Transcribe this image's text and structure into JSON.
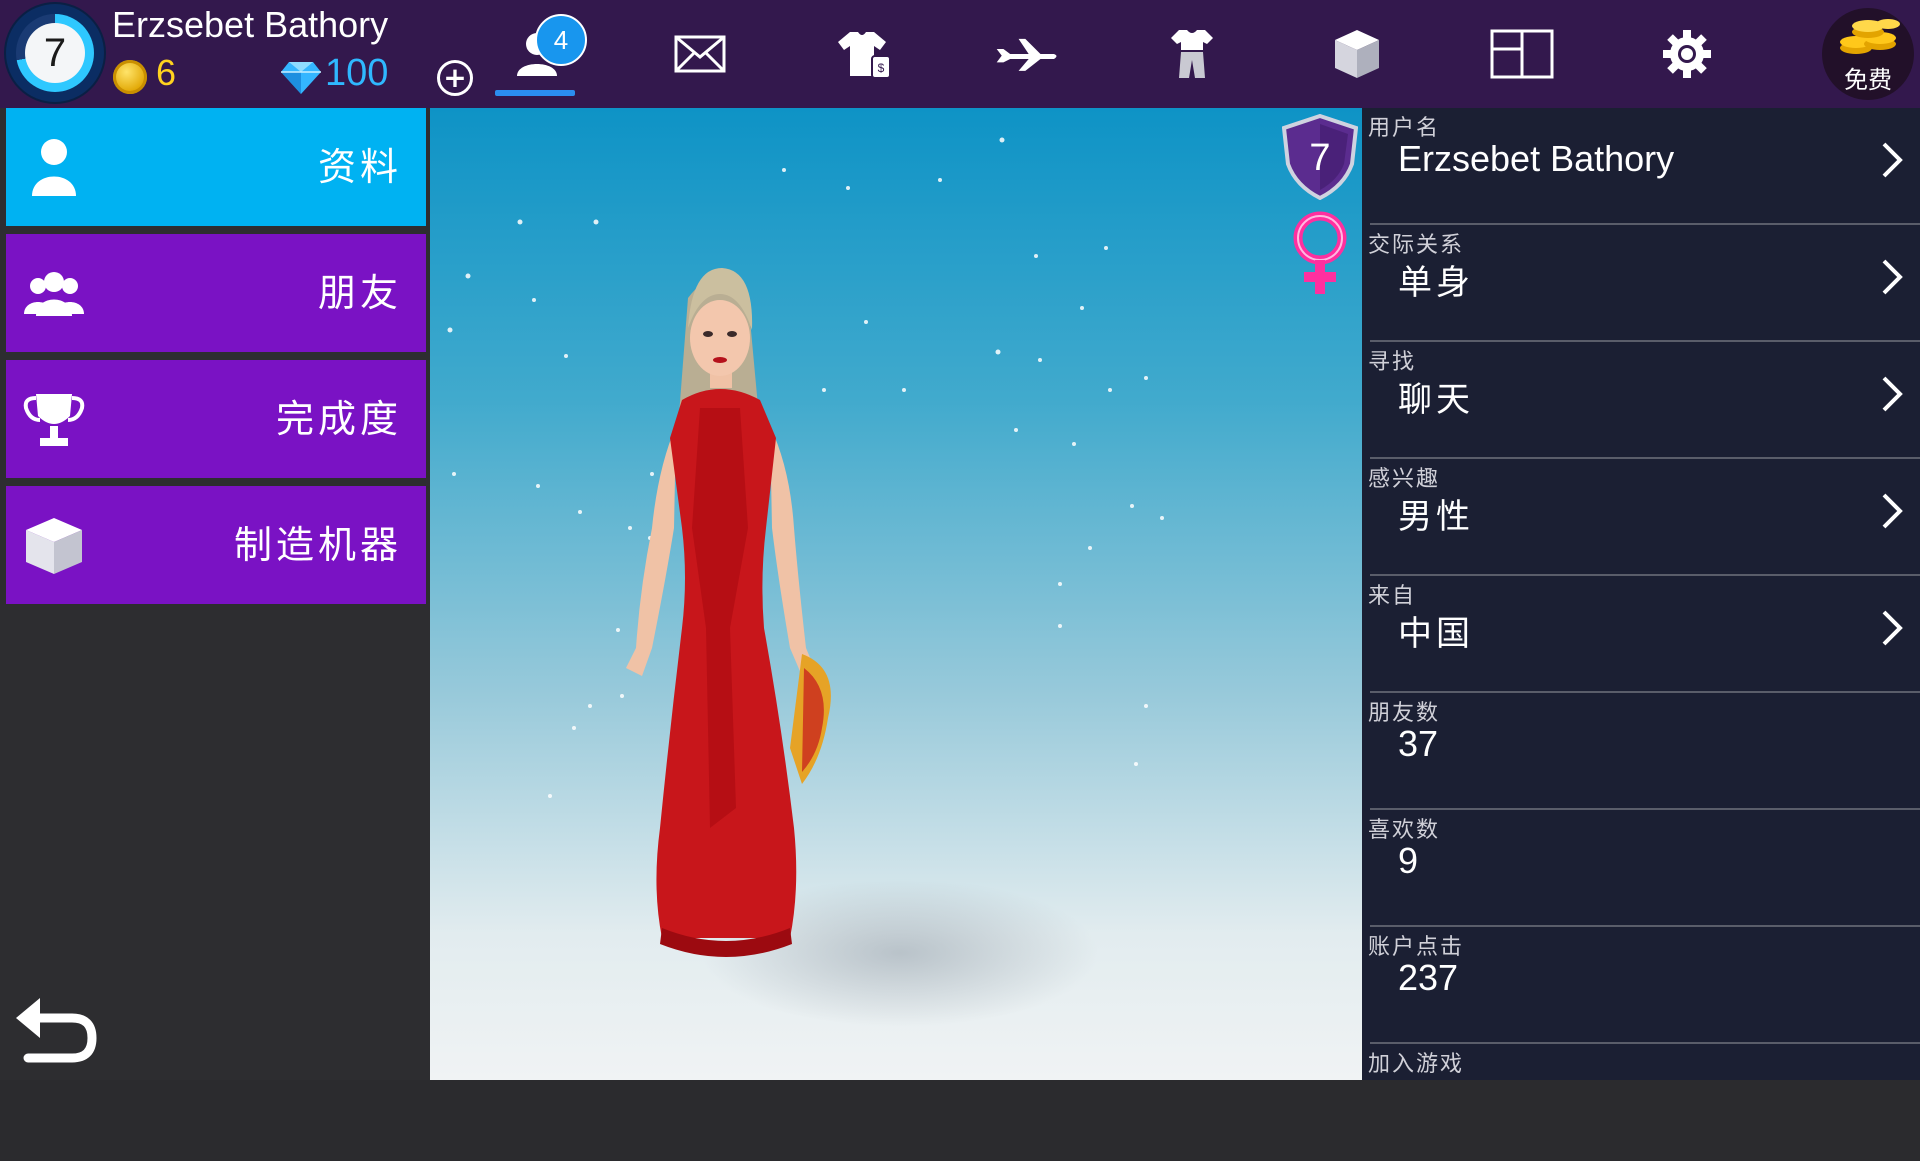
{
  "header": {
    "player_level": "7",
    "player_name": "Erzsebet Bathory",
    "coins": "6",
    "gems": "100",
    "friend_requests": "4",
    "free_label": "免费"
  },
  "sidebar": {
    "items": [
      {
        "label": "资料",
        "icon": "profile-icon",
        "active": true
      },
      {
        "label": "朋友",
        "icon": "friends-icon",
        "active": false
      },
      {
        "label": "完成度",
        "icon": "trophy-icon",
        "active": false
      },
      {
        "label": "制造机器",
        "icon": "cube-icon",
        "active": false
      }
    ]
  },
  "viewport": {
    "avatar_level": "7",
    "gender": "female"
  },
  "profile": {
    "fields": [
      {
        "label": "用户名",
        "value": "Erzsebet Bathory",
        "editable": true
      },
      {
        "label": "交际关系",
        "value": "单身",
        "editable": true
      },
      {
        "label": "寻找",
        "value": "聊天",
        "editable": true
      },
      {
        "label": "感兴趣",
        "value": "男性",
        "editable": true
      },
      {
        "label": "来自",
        "value": "中国",
        "editable": true
      },
      {
        "label": "朋友数",
        "value": "37",
        "editable": false
      },
      {
        "label": "喜欢数",
        "value": "9",
        "editable": false
      },
      {
        "label": "账户点击",
        "value": "237",
        "editable": false
      },
      {
        "label": "加入游戏",
        "value": "",
        "editable": false
      }
    ]
  },
  "colors": {
    "topbar": "#33184d",
    "sidebar_active": "#00b2f2",
    "sidebar_item": "#7a12c4",
    "panel": "#1b1f33",
    "coin": "#ffd21f",
    "gem": "#2fb8ff"
  }
}
